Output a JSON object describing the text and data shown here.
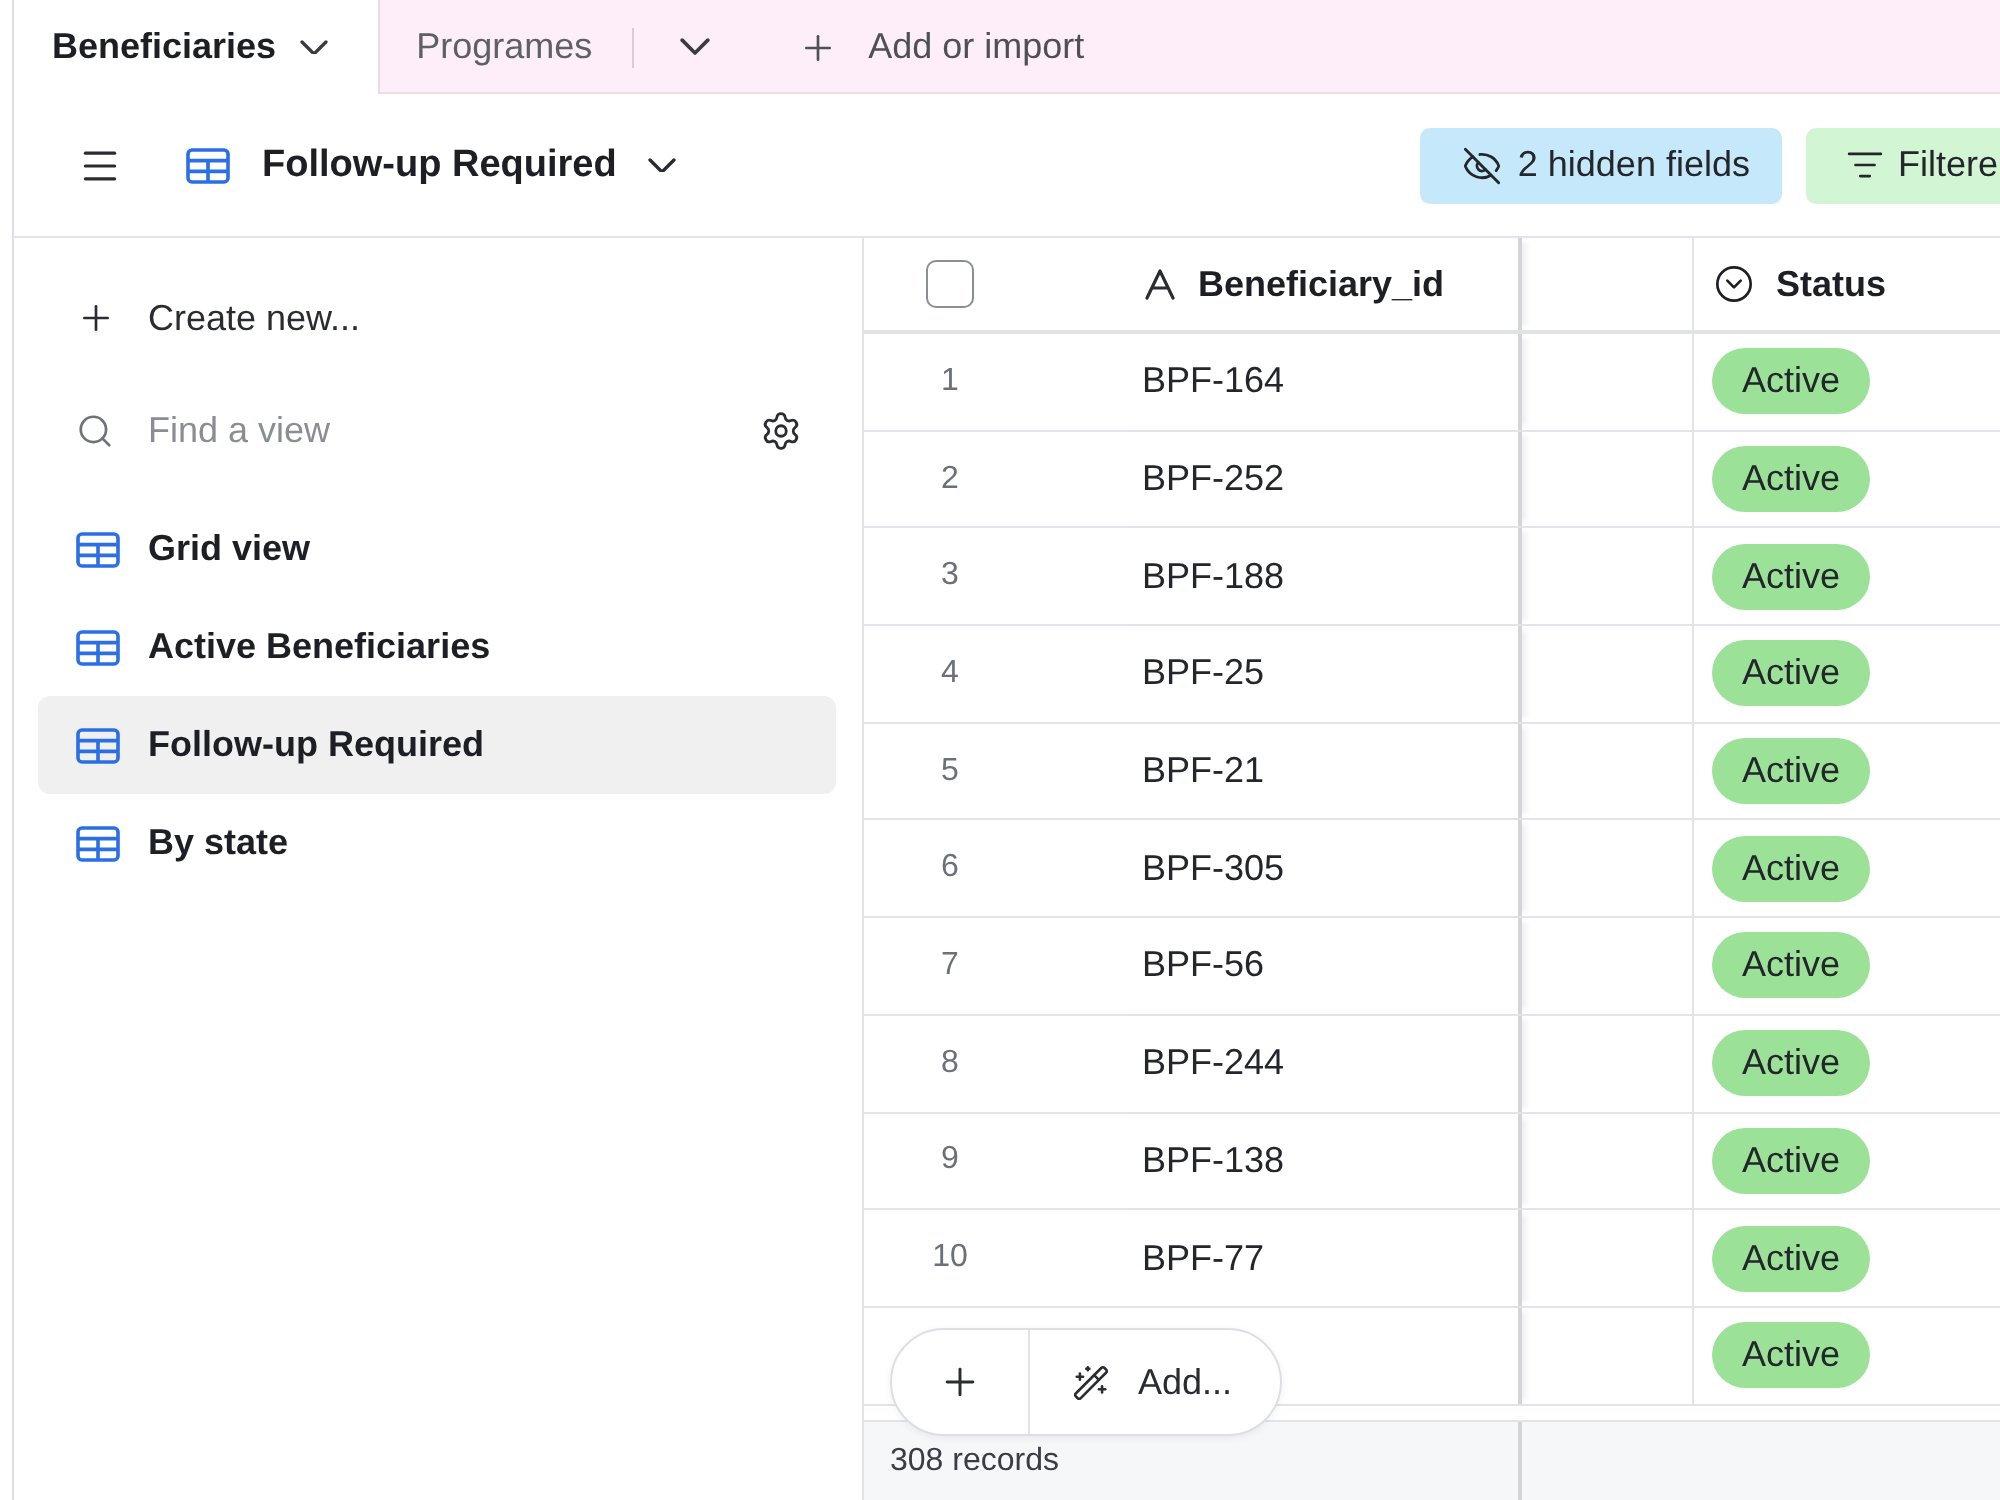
{
  "tabs": [
    {
      "label": "Beneficiaries",
      "selected": true
    },
    {
      "label": "Programes",
      "selected": false
    }
  ],
  "add_table": {
    "label": "Add or import"
  },
  "toolbar": {
    "view_name": "Follow-up Required",
    "hidden_fields": "2 hidden fields",
    "filter": "Filtere"
  },
  "sidebar": {
    "create_label": "Create new...",
    "search": {
      "placeholder": "Find a view"
    },
    "views": [
      {
        "label": "Grid view",
        "selected": false
      },
      {
        "label": "Active Beneficiaries",
        "selected": false
      },
      {
        "label": "Follow-up Required",
        "selected": true
      },
      {
        "label": "By state",
        "selected": false
      }
    ]
  },
  "grid": {
    "columns": [
      {
        "kind": "select_all",
        "checked": false
      },
      {
        "kind": "text",
        "label": "Beneficiary_id"
      },
      {
        "kind": "blank"
      },
      {
        "kind": "single_select",
        "label": "Status"
      }
    ],
    "rows": [
      {
        "number": "1",
        "beneficiary_id": "BPF-164",
        "status": "Active"
      },
      {
        "number": "2",
        "beneficiary_id": "BPF-252",
        "status": "Active"
      },
      {
        "number": "3",
        "beneficiary_id": "BPF-188",
        "status": "Active"
      },
      {
        "number": "4",
        "beneficiary_id": "BPF-25",
        "status": "Active"
      },
      {
        "number": "5",
        "beneficiary_id": "BPF-21",
        "status": "Active"
      },
      {
        "number": "6",
        "beneficiary_id": "BPF-305",
        "status": "Active"
      },
      {
        "number": "7",
        "beneficiary_id": "BPF-56",
        "status": "Active"
      },
      {
        "number": "8",
        "beneficiary_id": "BPF-244",
        "status": "Active"
      },
      {
        "number": "9",
        "beneficiary_id": "BPF-138",
        "status": "Active"
      },
      {
        "number": "10",
        "beneficiary_id": "BPF-77",
        "status": "Active"
      },
      {
        "status": "Active"
      }
    ]
  },
  "add_bar": {
    "label": "Add..."
  },
  "footer": {
    "record_count": "308 records"
  }
}
